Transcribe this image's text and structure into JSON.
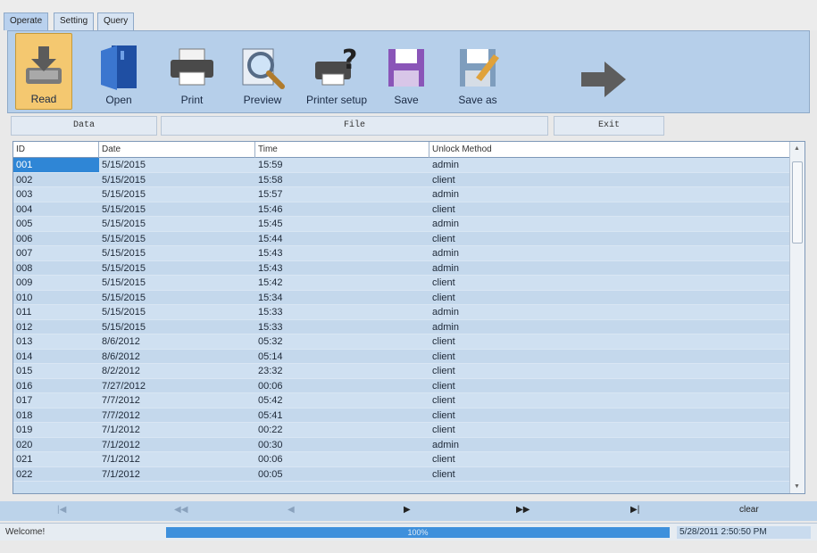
{
  "tabs": [
    {
      "label": "Operate",
      "active": true
    },
    {
      "label": "Setting",
      "active": false
    },
    {
      "label": "Query",
      "active": false
    }
  ],
  "toolbar": {
    "read": "Read",
    "open": "Open",
    "print": "Print",
    "preview": "Preview",
    "printer_setup": "Printer setup",
    "save": "Save",
    "save_as": "Save as",
    "exit_icon": "arrow-right-icon"
  },
  "groups": {
    "data": "Data",
    "file": "File",
    "exit": "Exit"
  },
  "table": {
    "columns": [
      "ID",
      "Date",
      "Time",
      "Unlock Method"
    ],
    "rows": [
      [
        "001",
        "5/15/2015",
        "15:59",
        "admin"
      ],
      [
        "002",
        "5/15/2015",
        "15:58",
        "client"
      ],
      [
        "003",
        "5/15/2015",
        "15:57",
        "admin"
      ],
      [
        "004",
        "5/15/2015",
        "15:46",
        "client"
      ],
      [
        "005",
        "5/15/2015",
        "15:45",
        "admin"
      ],
      [
        "006",
        "5/15/2015",
        "15:44",
        "client"
      ],
      [
        "007",
        "5/15/2015",
        "15:43",
        "admin"
      ],
      [
        "008",
        "5/15/2015",
        "15:43",
        "admin"
      ],
      [
        "009",
        "5/15/2015",
        "15:42",
        "client"
      ],
      [
        "010",
        "5/15/2015",
        "15:34",
        "client"
      ],
      [
        "011",
        "5/15/2015",
        "15:33",
        "admin"
      ],
      [
        "012",
        "5/15/2015",
        "15:33",
        "admin"
      ],
      [
        "013",
        "8/6/2012",
        "05:32",
        "client"
      ],
      [
        "014",
        "8/6/2012",
        "05:14",
        "client"
      ],
      [
        "015",
        "8/2/2012",
        "23:32",
        "client"
      ],
      [
        "016",
        "7/27/2012",
        "00:06",
        "client"
      ],
      [
        "017",
        "7/7/2012",
        "05:42",
        "client"
      ],
      [
        "018",
        "7/7/2012",
        "05:41",
        "client"
      ],
      [
        "019",
        "7/1/2012",
        "00:22",
        "client"
      ],
      [
        "020",
        "7/1/2012",
        "00:30",
        "admin"
      ],
      [
        "021",
        "7/1/2012",
        "00:06",
        "client"
      ],
      [
        "022",
        "7/1/2012",
        "00:05",
        "client"
      ]
    ],
    "selected_row": 0
  },
  "nav": {
    "first": "|◀",
    "prev_page": "◀◀",
    "prev": "◀",
    "next": "▶",
    "next_page": "▶▶",
    "last": "▶|",
    "clear": "clear"
  },
  "status": {
    "message": "Welcome!",
    "progress_label": "100%",
    "progress_fraction": 1.0,
    "datetime": "5/28/2011 2:50:50 PM"
  },
  "colors": {
    "toolbar_bg": "#b6cfea",
    "row_bg": "#c8dcef",
    "selection": "#2f86d6",
    "progress": "#3e90dc"
  }
}
